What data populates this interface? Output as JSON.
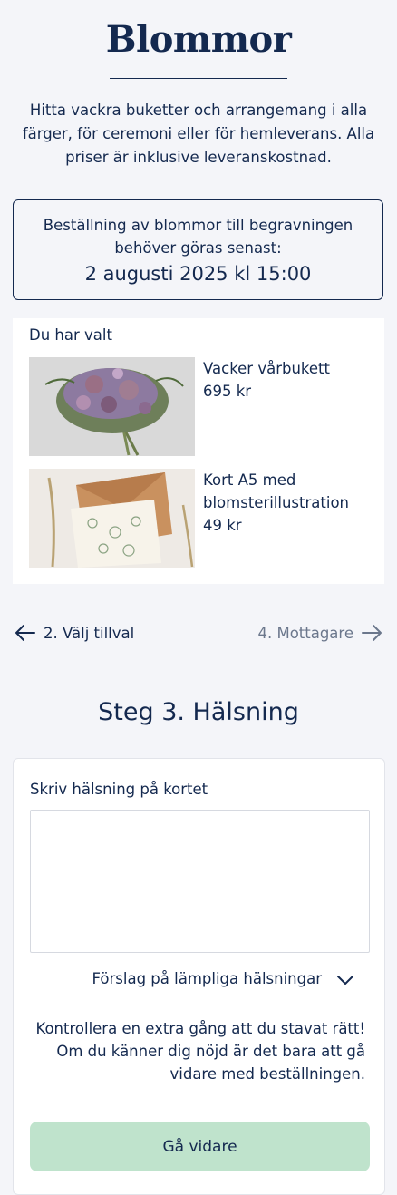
{
  "page": {
    "title": "Blommor",
    "intro": "Hitta vackra buketter och arrangemang i alla färger, för ceremoni eller för hemleverans. Alla priser är inklusive leveranskostnad."
  },
  "deadline": {
    "label": "Beställning av blommor till begravningen behöver göras senast:",
    "date": "2 augusti 2025 kl 15:00"
  },
  "selected": {
    "header": "Du har valt",
    "items": [
      {
        "name": "Vacker vårbukett",
        "price": "695 kr",
        "image": "bouquet-image"
      },
      {
        "name": "Kort A5 med blomsterillustration",
        "price": "49 kr",
        "image": "card-image"
      }
    ]
  },
  "nav": {
    "back_label": "2. Välj tillval",
    "next_label": "4. Mottagare"
  },
  "step": {
    "heading": "Steg 3. Hälsning",
    "field_label": "Skriv hälsning på kortet",
    "field_value": "",
    "suggestions_label": "Förslag på lämpliga hälsningar",
    "note": "Kontrollera en extra gång att du stavat rätt! Om du känner dig nöjd är det bara att gå vidare med beställningen.",
    "continue_label": "Gå vidare"
  },
  "colors": {
    "primary": "#14294f",
    "background": "#f4f5f9",
    "button": "#bfe3cc",
    "muted": "#6b778c"
  }
}
